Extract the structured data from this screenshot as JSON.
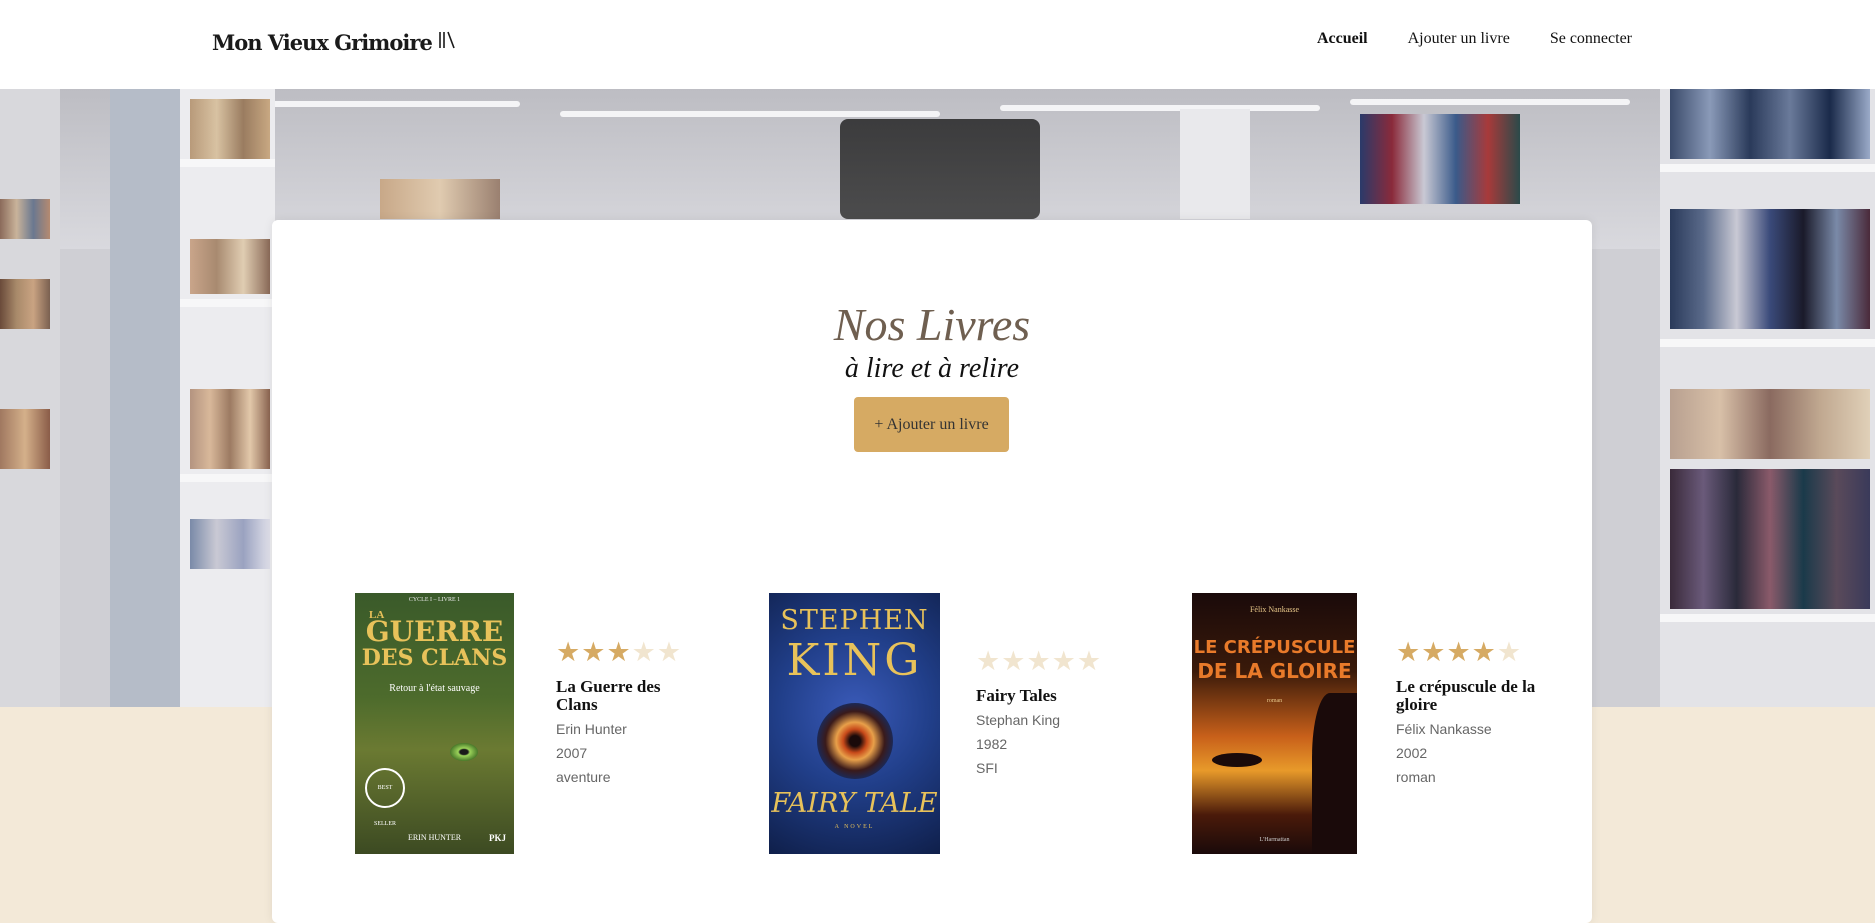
{
  "header": {
    "logo_text": "Mon Vieux Grimoire",
    "logo_icon": "books-icon",
    "nav": [
      {
        "label": "Accueil",
        "active": true
      },
      {
        "label": "Ajouter un livre",
        "active": false
      },
      {
        "label": "Se connecter",
        "active": false
      }
    ]
  },
  "main": {
    "title": "Nos Livres",
    "subtitle": "à lire et à relire",
    "add_button": "+ Ajouter un livre"
  },
  "colors": {
    "accent": "#d6aa63",
    "star_filled": "#d6aa63",
    "star_empty": "#f1e5cf",
    "beige_band": "#f3e9d8"
  },
  "books": [
    {
      "title": "La Guerre des Clans",
      "author": "Erin Hunter",
      "year": "2007",
      "genre": "aventure",
      "rating": 3,
      "cover": {
        "series": "CYCLE I – LIVRE 1",
        "line1": "LA",
        "line2": "GUERRE",
        "line3": "DES CLANS",
        "tagline": "Retour à l'état sauvage",
        "author": "ERIN HUNTER",
        "badge": "BEST SELLER",
        "publisher": "PKJ"
      }
    },
    {
      "title": "Fairy Tales",
      "author": "Stephan King",
      "year": "1982",
      "genre": "SFI",
      "rating": 0,
      "cover": {
        "line1": "STEPHEN",
        "line2": "KING",
        "line3": "FAIRY TALE",
        "tagline": "A NOVEL"
      }
    },
    {
      "title": "Le crépuscule de la gloire",
      "author": "Félix Nankasse",
      "year": "2002",
      "genre": "roman",
      "rating": 4,
      "cover": {
        "author": "Félix Nankasse",
        "line1": "LE CRÉPUSCULE",
        "line2": "DE LA GLOIRE",
        "tagline": "roman",
        "publisher": "L'Harmattan"
      }
    }
  ]
}
